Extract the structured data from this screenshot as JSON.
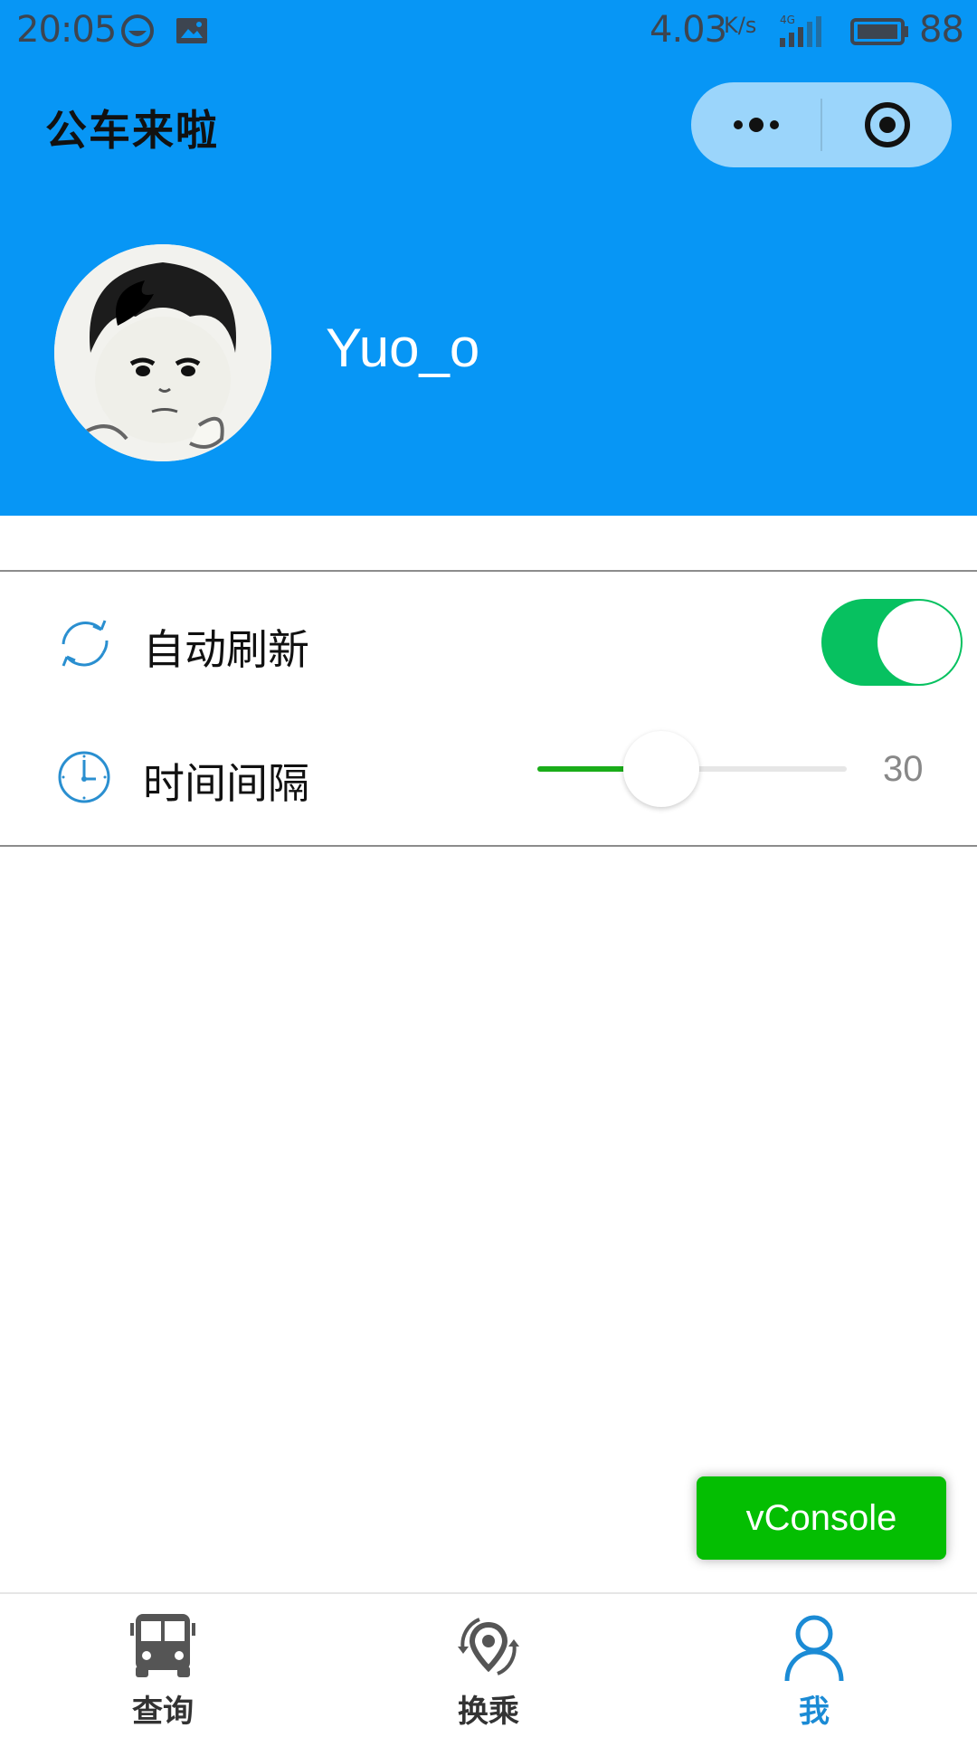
{
  "status_bar": {
    "time": "20:05",
    "speed": "4.03",
    "speed_unit": "K/s",
    "network": "4G",
    "battery": "88"
  },
  "header": {
    "title": "公车来啦",
    "username": "Yuo_o",
    "background_color": "#0796f5"
  },
  "settings": {
    "auto_refresh": {
      "label": "自动刷新",
      "icon": "refresh-icon",
      "enabled": true
    },
    "interval": {
      "label": "时间间隔",
      "icon": "clock-icon",
      "value": "30",
      "slider_fraction": 0.4
    }
  },
  "vconsole": {
    "label": "vConsole"
  },
  "tabbar": {
    "tabs": [
      {
        "label": "查询",
        "icon": "bus-icon",
        "active": false
      },
      {
        "label": "换乘",
        "icon": "transfer-location-icon",
        "active": false
      },
      {
        "label": "我",
        "icon": "person-icon",
        "active": true
      }
    ]
  },
  "colors": {
    "accent_green": "#07c160",
    "active_tab": "#1b8bd5",
    "icon_blue": "#2a8fd0"
  }
}
